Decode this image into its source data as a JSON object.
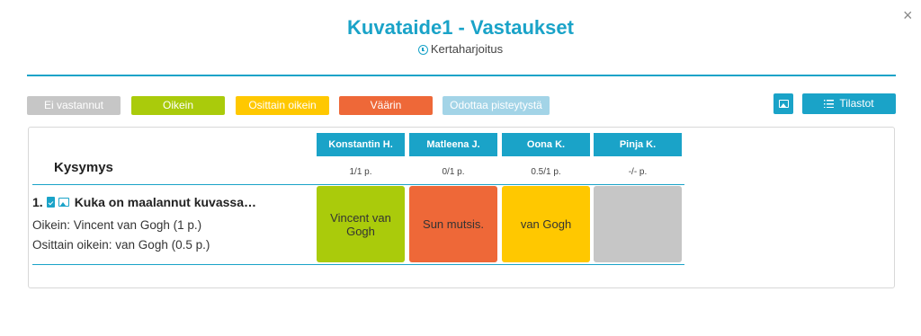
{
  "header": {
    "title": "Kuvataide1 - Vastaukset",
    "subtitle": "Kertaharjoitus",
    "close_label": "×"
  },
  "legend": [
    {
      "label": "Ei vastannut",
      "color": "#c6c6c6"
    },
    {
      "label": "Oikein",
      "color": "#aacb0b"
    },
    {
      "label": "Osittain oikein",
      "color": "#ffc800"
    },
    {
      "label": "Väärin",
      "color": "#ee6838"
    },
    {
      "label": "Odottaa pisteytystä",
      "color": "#a3d4e7"
    }
  ],
  "toolbar": {
    "stats_label": "Tilastot"
  },
  "table": {
    "question_header": "Kysymys",
    "students": [
      {
        "name": "Konstantin H.",
        "score": "1/1 p."
      },
      {
        "name": "Matleena J.",
        "score": "0/1 p."
      },
      {
        "name": "Oona K.",
        "score": "0.5/1 p."
      },
      {
        "name": "Pinja K.",
        "score": "-/- p."
      }
    ],
    "questions": [
      {
        "number": "1.",
        "title": "Kuka on maalannut kuvassa…",
        "correct": "Oikein: Vincent van Gogh (1 p.)",
        "partial": "Osittain oikein: van Gogh (0.5 p.)",
        "answers": [
          {
            "text": "Vincent van Gogh",
            "status": "Oikein",
            "color": "#aacb0b"
          },
          {
            "text": "Sun mutsis.",
            "status": "Väärin",
            "color": "#ee6838"
          },
          {
            "text": "van Gogh",
            "status": "Osittain oikein",
            "color": "#ffc800"
          },
          {
            "text": "",
            "status": "Ei vastannut",
            "color": "#c6c6c6"
          }
        ]
      }
    ]
  }
}
